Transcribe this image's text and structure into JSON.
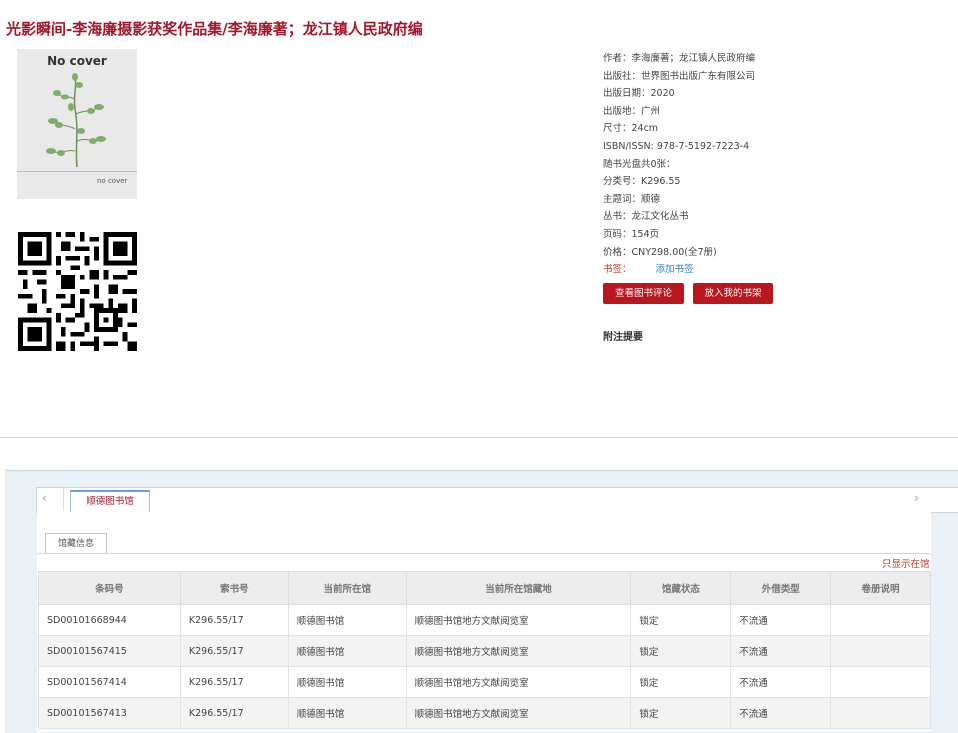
{
  "page_title": "光影瞬间-李海廉摄影获奖作品集/李海廉著；龙江镇人民政府编",
  "cover": {
    "text_main": "No cover",
    "text_small": "no cover"
  },
  "info_rows": [
    "作者：李海廉著；龙江镇人民政府编",
    "出版社：世界图书出版广东有限公司",
    "出版日期：2020",
    "出版地：广州",
    "尺寸：24cm",
    "ISBN/ISSN:  978-7-5192-7223-4",
    "随书光盘共0张：",
    "分类号：K296.55",
    "主题词：顺德",
    "丛书：龙江文化丛书",
    "页码：154页",
    "价格：CNY298.00(全7册)"
  ],
  "tags": {
    "label": "书签：",
    "add": "添加书签"
  },
  "buttons": {
    "review": "查看图书评论",
    "shelf": "放入我的书架"
  },
  "notes_label": "附注提要",
  "library_tab": "顺德图书馆",
  "holdings_tab": "馆藏信息",
  "only_show": "只显示在馆",
  "nav": {
    "prev": "‹",
    "next": "›"
  },
  "table": {
    "headers": [
      "条码号",
      "索书号",
      "当前所在馆",
      "当前所在馆藏地",
      "馆藏状态",
      "外借类型",
      "卷册说明"
    ],
    "rows": [
      [
        "SD00101668944",
        "K296.55/17",
        "顺德图书馆",
        "顺德图书馆地方文献阅览室",
        "锁定",
        "不流通",
        ""
      ],
      [
        "SD00101567415",
        "K296.55/17",
        "顺德图书馆",
        "顺德图书馆地方文献阅览室",
        "锁定",
        "不流通",
        ""
      ],
      [
        "SD00101567414",
        "K296.55/17",
        "顺德图书馆",
        "顺德图书馆地方文献阅览室",
        "锁定",
        "不流通",
        ""
      ],
      [
        "SD00101567413",
        "K296.55/17",
        "顺德图书馆",
        "顺德图书馆地方文献阅览室",
        "锁定",
        "不流通",
        ""
      ]
    ]
  },
  "icons": {
    "cover_image": "plant-icon",
    "qr": "qr-code-icon"
  },
  "colors": {
    "accent": "#a3182d",
    "button": "#b8171f",
    "link": "#3a79c4"
  }
}
